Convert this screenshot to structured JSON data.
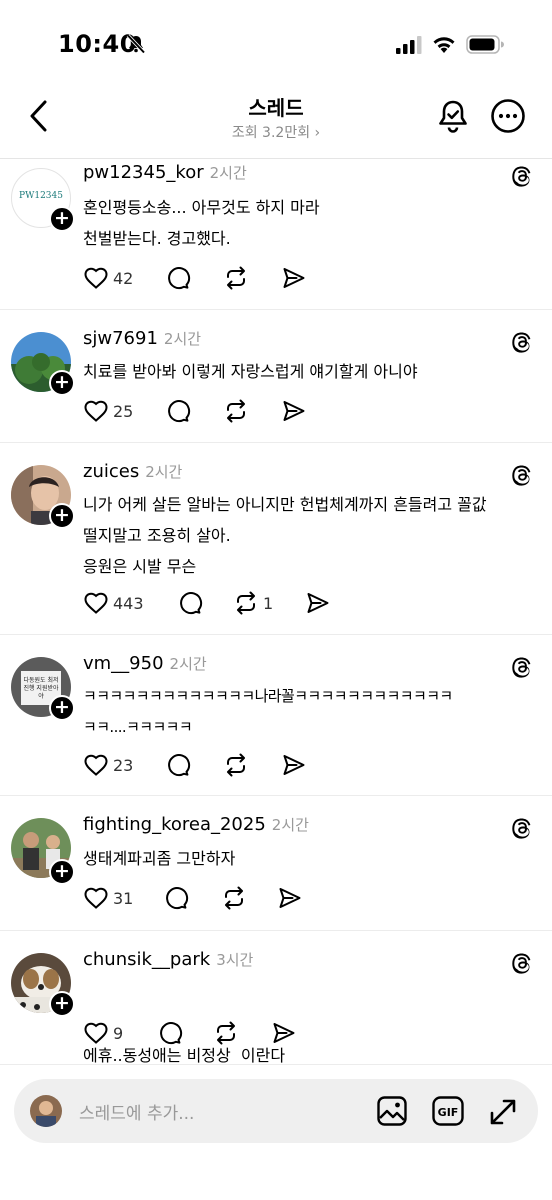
{
  "status_bar": {
    "time": "10:40"
  },
  "header": {
    "title": "스레드",
    "views": "조회 3.2만회 ›"
  },
  "posts": [
    {
      "username": "pw12345_kor",
      "time": "2시간",
      "avatar_text": "PW12345",
      "lines": [
        "혼인평등소송... 아무것도 하지 마라",
        "천벌받는다. 경고했다."
      ],
      "likes": "42",
      "reposts": ""
    },
    {
      "username": "sjw7691",
      "time": "2시간",
      "lines": [
        "치료를 받아봐 이렇게 자랑스럽게 얘기할게 아니야"
      ],
      "likes": "25",
      "reposts": ""
    },
    {
      "username": "zuices",
      "time": "2시간",
      "lines": [
        "니가 어케 살든 알바는 아니지만 헌법체계까지 흔들려고 꼴값",
        "떨지말고 조용히 살아.",
        "응원은 시발 무슨"
      ],
      "likes": "443",
      "reposts": "1"
    },
    {
      "username": "vm__950",
      "time": "2시간",
      "avatar_text": "다동원도 최저진행 지원받아야",
      "lines": [
        "ㅋㅋㅋㅋㅋㅋㅋㅋㅋㅋㅋㅋㅋ나라꼴ㅋㅋㅋㅋㅋㅋㅋㅋㅋㅋㅋㅋ",
        "ㅋㅋ....ㅋㅋㅋㅋㅋ"
      ],
      "likes": "23",
      "reposts": ""
    },
    {
      "username": "fighting_korea_2025",
      "time": "2시간",
      "lines": [
        "생태계파괴좀 그만하자"
      ],
      "likes": "31",
      "reposts": ""
    },
    {
      "username": "chunsik__park",
      "time": "3시간",
      "lines": [
        "에휴..동성애는 비정상  이란다"
      ],
      "likes": "9",
      "reposts": ""
    }
  ],
  "composer": {
    "placeholder": "스레드에 추가..."
  }
}
